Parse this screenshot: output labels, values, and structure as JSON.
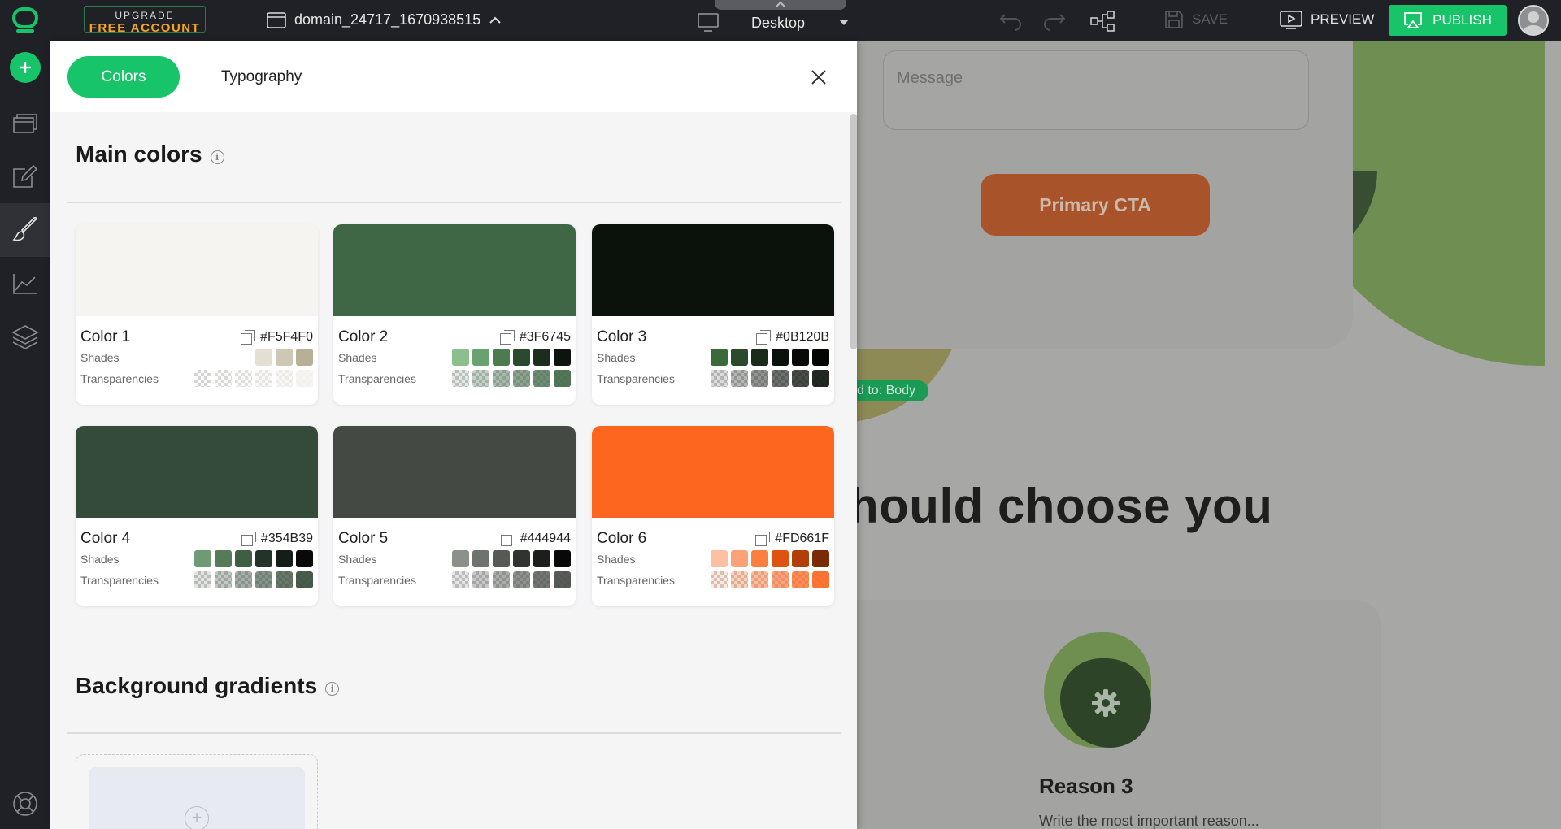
{
  "topbar": {
    "upgrade_line1": "UPGRADE",
    "upgrade_line2": "FREE ACCOUNT",
    "domain": "domain_24717_1670938515",
    "device": "Desktop",
    "save": "SAVE",
    "preview": "PREVIEW",
    "publish": "PUBLISH"
  },
  "panel": {
    "tabs": {
      "colors": "Colors",
      "typography": "Typography"
    },
    "main_colors_title": "Main colors",
    "gradients_title": "Background gradients",
    "shades_label": "Shades",
    "transparencies_label": "Transparencies",
    "colors": [
      {
        "name": "Color 1",
        "hex": "#F5F4F0",
        "shades": [
          "#e3e0d3",
          "#cdc7b3",
          "#b8b096"
        ],
        "trans": [
          "#f5f4f0",
          "#f5f4f0",
          "#f5f4f0",
          "#f5f4f0",
          "#f5f4f0",
          "#f5f4f0"
        ]
      },
      {
        "name": "Color 2",
        "hex": "#3F6745",
        "shades": [
          "#8cbf8e",
          "#6aa170",
          "#4a7c4f",
          "#2a4a2e",
          "#1b2e1d",
          "#0c140d"
        ],
        "trans": [
          "#3f6745",
          "#3f6745",
          "#3f6745",
          "#3f6745",
          "#3f6745",
          "#3f6745"
        ]
      },
      {
        "name": "Color 3",
        "hex": "#0B120B",
        "shades": [
          "#3a6a3a",
          "#2a4a2b",
          "#1a2a1b",
          "#0b120b",
          "#070a07",
          "#030503"
        ],
        "trans": [
          "#0b120b",
          "#0b120b",
          "#0b120b",
          "#0b120b",
          "#0b120b",
          "#0b120b"
        ]
      },
      {
        "name": "Color 4",
        "hex": "#354B39",
        "shades": [
          "#6e9a74",
          "#557b5b",
          "#3f5f44",
          "#24332a",
          "#141d17",
          "#070a08"
        ],
        "trans": [
          "#354b39",
          "#354b39",
          "#354b39",
          "#354b39",
          "#354b39",
          "#354b39"
        ]
      },
      {
        "name": "Color 5",
        "hex": "#444944",
        "shades": [
          "#8a918a",
          "#6d736d",
          "#555a55",
          "#303330",
          "#1c1e1c",
          "#070807"
        ],
        "trans": [
          "#444944",
          "#444944",
          "#444944",
          "#444944",
          "#444944",
          "#444944"
        ]
      },
      {
        "name": "Color 6",
        "hex": "#FD661F",
        "shades": [
          "#fdc0a2",
          "#fda177",
          "#fd7f3f",
          "#e0520f",
          "#b23f08",
          "#7a2a04"
        ],
        "trans": [
          "#fd661f",
          "#fd661f",
          "#fd661f",
          "#fd661f",
          "#fd661f",
          "#fd661f"
        ]
      }
    ]
  },
  "canvas": {
    "message_placeholder": "Message",
    "cta_label": "Primary CTA",
    "applied_badge": "d to: Body",
    "headline": "hould choose you",
    "reason_title": "Reason 3",
    "reason_text": "Write the most important reason..."
  }
}
